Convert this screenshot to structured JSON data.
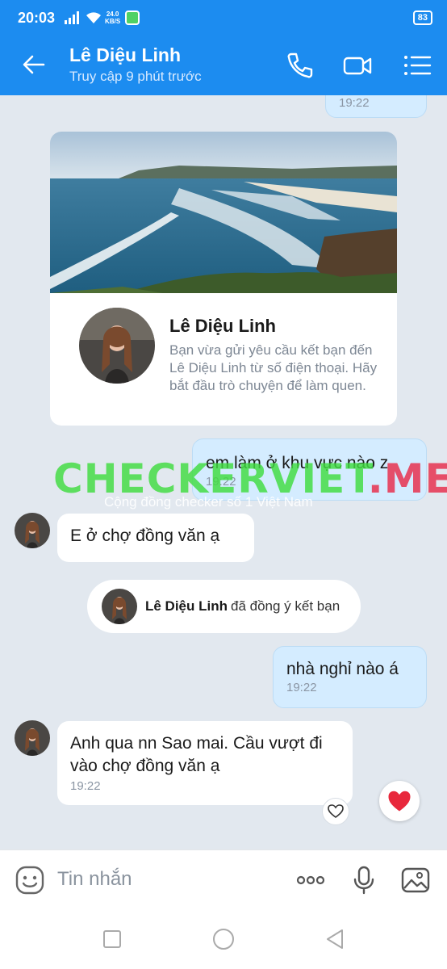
{
  "status_bar": {
    "time": "20:03",
    "speed_value": "24.0",
    "speed_unit": "KB/S",
    "battery": "83"
  },
  "header": {
    "title": "Lê Diệu Linh",
    "subtitle": "Truy cập 9 phút trước"
  },
  "card": {
    "name": "Lê Diệu Linh",
    "description": "Bạn vừa gửi yêu cầu kết bạn đến Lê Diệu Linh từ số điện thoại. Hãy bắt đầu trò chuyện để làm quen."
  },
  "messages": {
    "top_time": "19:22",
    "m1_text": "em làm ở khu vực nào z",
    "m1_time": "19:22",
    "m2_text": "E ở chợ đồng văn ạ",
    "notice_name": "Lê Diệu Linh",
    "notice_text": "đã đồng ý kết bạn",
    "m3_text": "nhà nghỉ nào á",
    "m3_time": "19:22",
    "m4_text": "Anh qua nn Sao mai. Cầu vượt đi vào chợ đồng văn ạ",
    "m4_time": "19:22"
  },
  "watermark": {
    "main": "CHECKERVIET",
    "suffix": ".ME",
    "sub": "Cộng đồng checker số 1 Việt Nam"
  },
  "input": {
    "placeholder": "Tin nhắn"
  },
  "colors": {
    "brand": "#1c8cf0",
    "chat_bg": "#e2e8ef",
    "my_bubble": "#d4ecff",
    "heart": "#e8283c"
  }
}
